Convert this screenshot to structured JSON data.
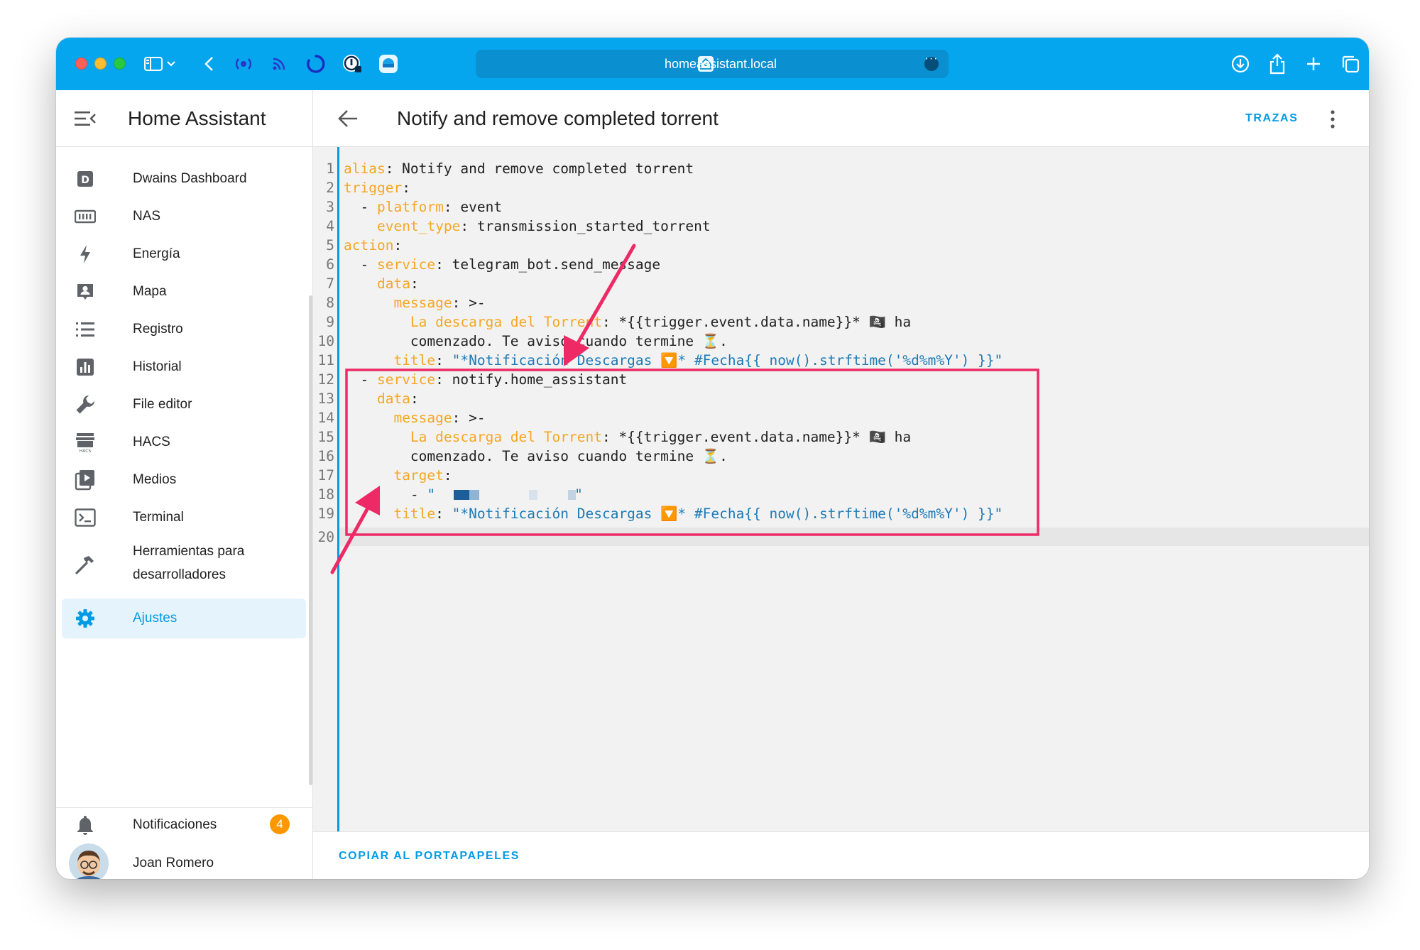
{
  "browser": {
    "url": "homeassistant.local"
  },
  "sidebar": {
    "title": "Home Assistant",
    "items": [
      {
        "label": "Dwains Dashboard",
        "icon": "dashboard-d-icon"
      },
      {
        "label": "NAS",
        "icon": "nas-icon"
      },
      {
        "label": "Energía",
        "icon": "lightning-icon"
      },
      {
        "label": "Mapa",
        "icon": "map-person-icon"
      },
      {
        "label": "Registro",
        "icon": "list-icon"
      },
      {
        "label": "Historial",
        "icon": "bar-chart-icon"
      },
      {
        "label": "File editor",
        "icon": "wrench-icon"
      },
      {
        "label": "HACS",
        "icon": "hacs-store-icon"
      },
      {
        "label": "Medios",
        "icon": "media-play-icon"
      },
      {
        "label": "Terminal",
        "icon": "terminal-icon"
      },
      {
        "label_line1": "Herramientas para",
        "label_line2": "desarrolladores",
        "icon": "hammer-icon"
      },
      {
        "label": "Ajustes",
        "icon": "gear-icon",
        "active": true
      }
    ],
    "notifications": {
      "label": "Notificaciones",
      "count": "4"
    },
    "user": {
      "name": "Joan Romero"
    }
  },
  "main": {
    "title": "Notify and remove completed torrent",
    "traces_label": "TRAZAS",
    "copy_label": "COPIAR AL PORTAPAPELES"
  },
  "code": {
    "line_numbers": [
      "1",
      "2",
      "3",
      "4",
      "5",
      "6",
      "7",
      "8",
      "9",
      "10",
      "11",
      "12",
      "13",
      "14",
      "15",
      "16",
      "17",
      "18",
      "19",
      "20"
    ],
    "l1": {
      "k": "alias",
      "v": ": Notify and remove completed torrent"
    },
    "l2": {
      "k": "trigger",
      "v": ":"
    },
    "l3": {
      "pre": "  - ",
      "k": "platform",
      "v": ": event"
    },
    "l4": {
      "pre": "    ",
      "k": "event_type",
      "v": ": transmission_started_torrent"
    },
    "l5": {
      "k": "action",
      "v": ":"
    },
    "l6": {
      "pre": "  - ",
      "k": "service",
      "v": ": telegram_bot.send_message"
    },
    "l7": {
      "pre": "    ",
      "k": "data",
      "v": ":"
    },
    "l8": {
      "pre": "      ",
      "k": "message",
      "v": ": >-"
    },
    "l9": {
      "pre": "        ",
      "k": "La descarga del Torrent",
      "v": ": *{{trigger.event.data.name}}* 🏴‍☠️ ha"
    },
    "l10": {
      "pre": "        ",
      "v": "comenzado. Te aviso cuando termine ⏳."
    },
    "l11": {
      "pre": "      ",
      "k": "title",
      "v": ": ",
      "s": "\"*Notificación Descargas 🔽* #Fecha{{ now().strftime('%d%m%Y') }}\""
    },
    "l12": {
      "pre": "  - ",
      "k": "service",
      "v": ": notify.home_assistant"
    },
    "l13": {
      "pre": "    ",
      "k": "data",
      "v": ":"
    },
    "l14": {
      "pre": "      ",
      "k": "message",
      "v": ": >-"
    },
    "l15": {
      "pre": "        ",
      "k": "La descarga del Torrent",
      "v": ": *{{trigger.event.data.name}}* 🏴‍☠️ ha"
    },
    "l16": {
      "pre": "        ",
      "v": "comenzado. Te aviso cuando termine ⏳."
    },
    "l17": {
      "pre": "      ",
      "k": "target",
      "v": ":"
    },
    "l18": {
      "pre": "        - ",
      "s_open": "\"",
      "s_close": "\""
    },
    "l19": {
      "pre": "      ",
      "k": "title",
      "v": ": ",
      "s": "\"*Notificación Descargas 🔽* #Fecha{{ now().strftime('%d%m%Y') }}\""
    }
  },
  "colors": {
    "toolbar": "#05a6ee",
    "accent": "#039be5",
    "yaml_key": "#f6a623",
    "yaml_string": "#1d7ab5",
    "annotation": "#ee2a66",
    "badge": "#ff9800"
  }
}
